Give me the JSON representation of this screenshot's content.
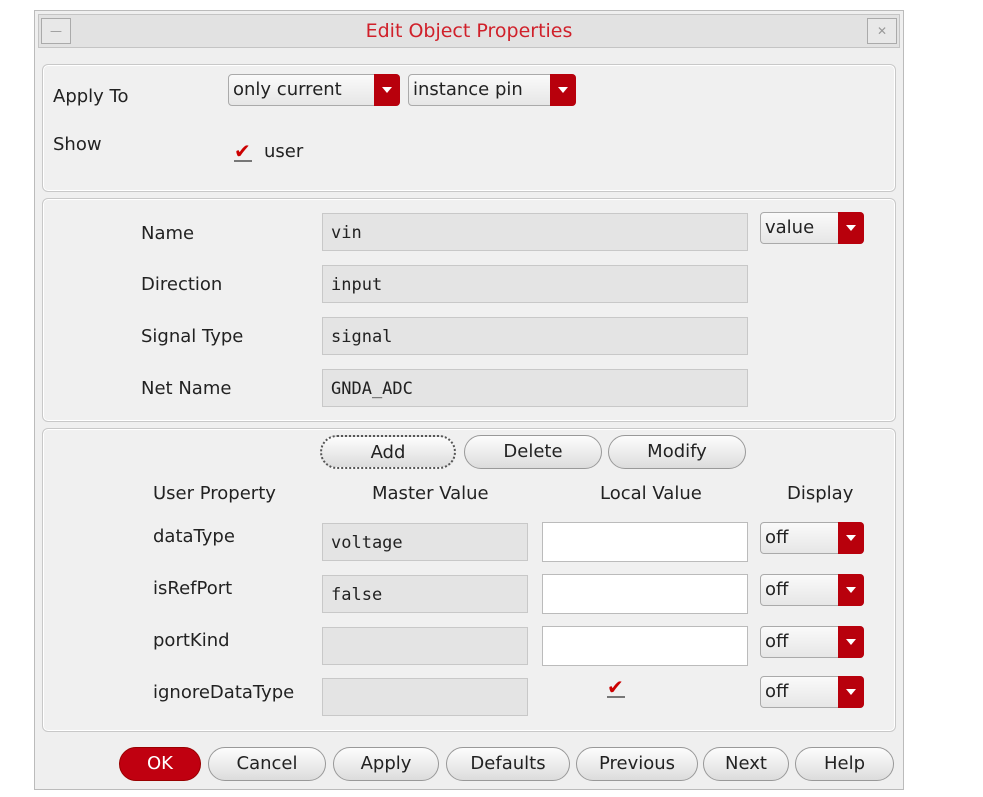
{
  "window": {
    "title": "Edit Object Properties",
    "minimize": "—",
    "close": "✕"
  },
  "apply_to": {
    "label": "Apply To",
    "scope": "only current",
    "type": "instance pin"
  },
  "show": {
    "label": "Show",
    "option": "user",
    "checked": true
  },
  "attrs": {
    "mode": "value",
    "rows": [
      {
        "label": "Name",
        "value": "vin"
      },
      {
        "label": "Direction",
        "value": "input"
      },
      {
        "label": "Signal Type",
        "value": "signal"
      },
      {
        "label": "Net Name",
        "value": "GNDA_ADC"
      }
    ]
  },
  "props": {
    "add": "Add",
    "delete": "Delete",
    "modify": "Modify",
    "headers": [
      "User Property",
      "Master Value",
      "Local Value",
      "Display"
    ],
    "rows": [
      {
        "name": "dataType",
        "master": "voltage",
        "local": "",
        "display": "off"
      },
      {
        "name": "isRefPort",
        "master": "false",
        "local": "",
        "display": "off"
      },
      {
        "name": "portKind",
        "master": "",
        "local": "",
        "display": "off"
      },
      {
        "name": "ignoreDataType",
        "master": "",
        "local_checked": true,
        "display": "off"
      }
    ]
  },
  "footer": {
    "ok": "OK",
    "cancel": "Cancel",
    "apply": "Apply",
    "defaults": "Defaults",
    "previous": "Previous",
    "next": "Next",
    "help": "Help"
  }
}
